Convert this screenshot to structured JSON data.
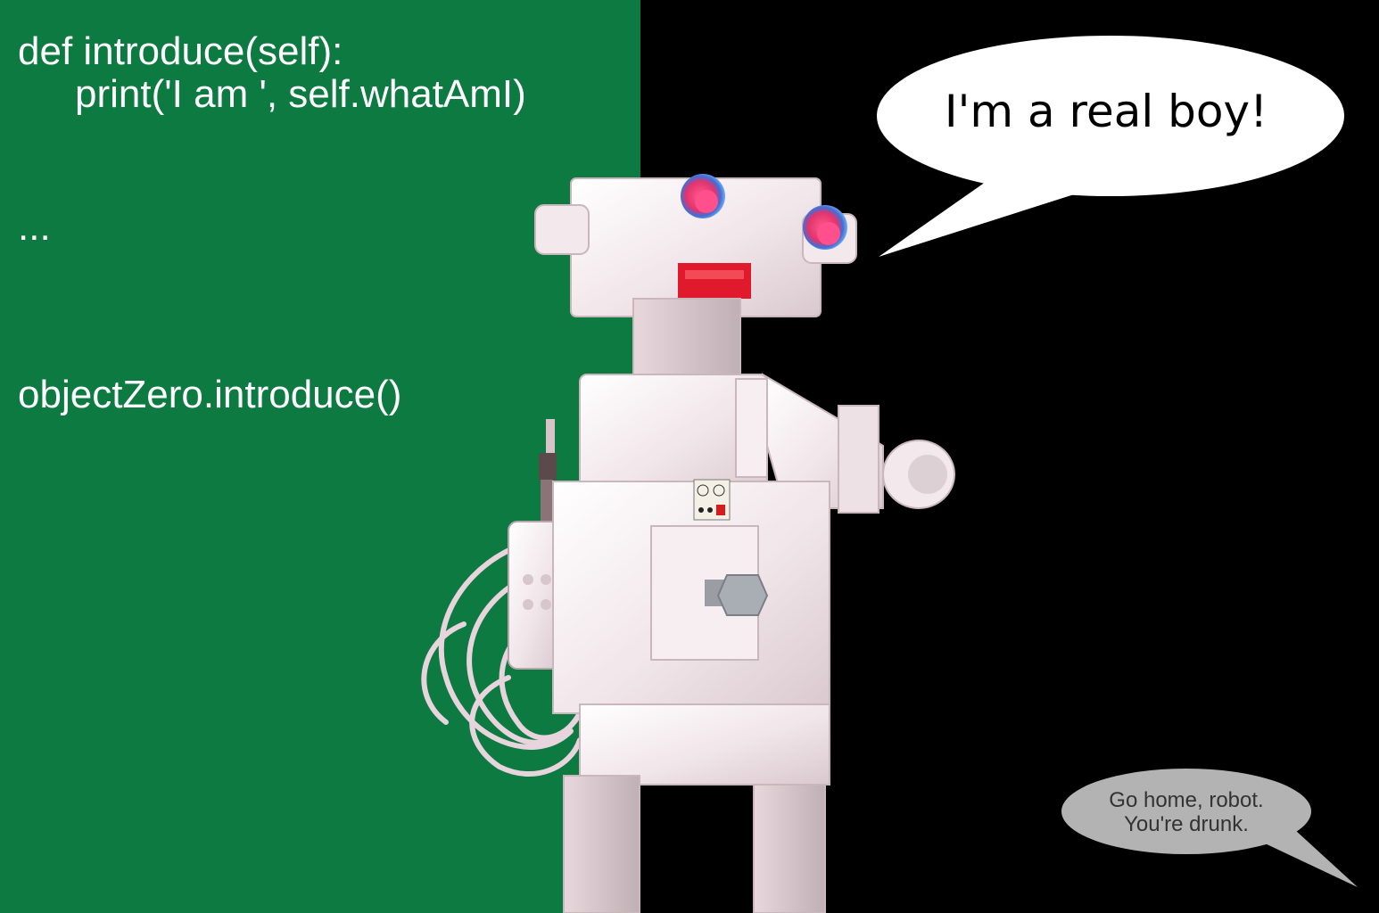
{
  "code": {
    "line1": "def introduce(self):",
    "line2": "print('I am ', self.whatAmI)",
    "line3": "...",
    "line4": "objectZero.introduce()"
  },
  "speech_bubble": {
    "text": "I'm a real boy!"
  },
  "thought_bubble": {
    "line1": "Go home, robot.",
    "line2": "You're drunk."
  },
  "colors": {
    "left_background": "#0c7a41",
    "right_background": "#000000",
    "code_text": "#ffffff",
    "speech_bubble": "#ffffff",
    "small_bubble": "#b3b3b3"
  },
  "robot": {
    "description_icon": "lego-robot"
  }
}
